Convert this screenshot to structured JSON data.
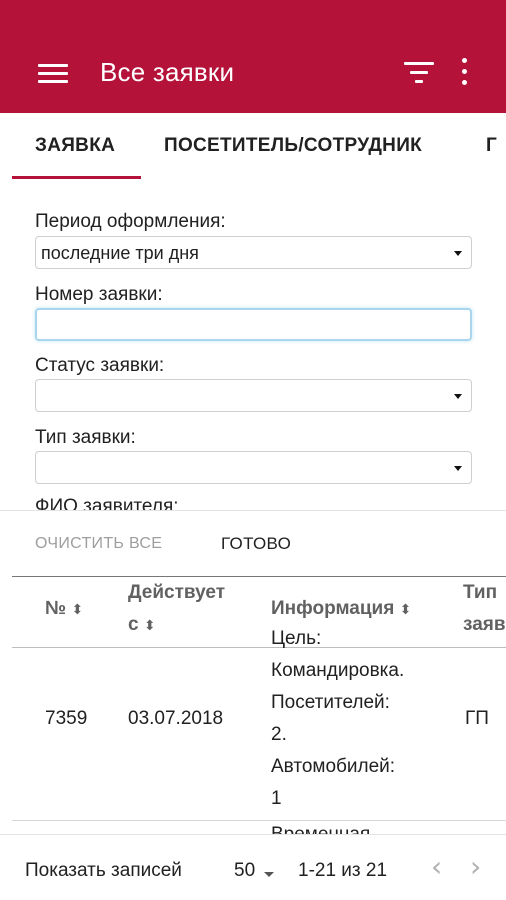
{
  "app": {
    "title": "Все заявки",
    "accent_color": "#b5123a",
    "icons": {
      "menu": "hamburger-menu-icon",
      "filter": "filter-icon",
      "more": "more-vertical-icon"
    }
  },
  "tabs": [
    {
      "label": "ЗАЯВКА",
      "active": true
    },
    {
      "label": "ПОСЕТИТЕЛЬ/СОТРУДНИК",
      "active": false
    },
    {
      "label": "Г",
      "active": false
    }
  ],
  "form": {
    "period_label": "Период оформления:",
    "period_value": "последние три дня",
    "number_label": "Номер заявки:",
    "number_value": "",
    "status_label": "Статус заявки:",
    "status_value": "",
    "type_label": "Тип заявки:",
    "type_value": "",
    "applicant_label": "ФИО заявителя:"
  },
  "actions": {
    "clear_label": "ОЧИСТИТЬ ВСЕ",
    "done_label": "ГОТОВО"
  },
  "table": {
    "columns": [
      {
        "line1": "№",
        "line2": ""
      },
      {
        "line1": "Действует",
        "line2": "с"
      },
      {
        "line1": "Информация",
        "line2": ""
      },
      {
        "line1": "Тип",
        "line2": "заяв"
      }
    ],
    "sort_symbol": "⬍",
    "rows": [
      {
        "number": "7359",
        "date": "03.07.2018",
        "info_lines": [
          "Цель:",
          "Командировка.",
          "Посетителей:",
          "2.",
          "Автомобилей:",
          "1"
        ],
        "type": "ГП"
      }
    ],
    "next_row_partial": "Временная"
  },
  "footer": {
    "show_label": "Показать записей",
    "per_page": "50",
    "range": "1-21 из 21",
    "prev_symbol": "‹",
    "next_symbol": "›"
  }
}
